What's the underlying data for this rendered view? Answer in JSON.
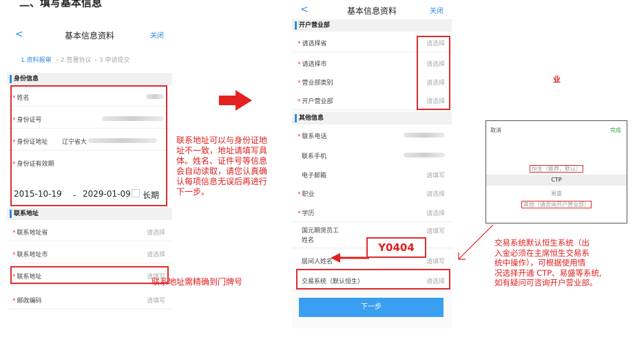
{
  "top_heading": "二、填写基本信息",
  "phone1": {
    "nav": {
      "back": "<",
      "title": "基本信息资料",
      "close": "关闭"
    },
    "steps": {
      "s1": "1.资料报审",
      "s2": "› 2.签署协议",
      "s3": "› 3.申请提交"
    },
    "sec_id": "身份信息",
    "name_label": "姓名",
    "id_label": "身份证号",
    "addr_label": "身份证地址",
    "addr_value": "辽宁省大",
    "validity_label": "身份证有效期",
    "date_start": "2015-10-19",
    "date_sep": "-",
    "date_end": "2029-01-09",
    "long_term": "长期",
    "sec_contact": "联系地址",
    "province_label": "联系地址省",
    "city_label": "联系地址市",
    "contact_addr_label": "联系地址",
    "zip_label": "邮政编码",
    "please_select": "请选择",
    "please_fill": "请填写"
  },
  "phone2": {
    "nav": {
      "back": "<",
      "title": "基本信息资料",
      "close": "关闭"
    },
    "sec_open": "开户营业部",
    "province": "请选择省",
    "city": "请选择市",
    "dept_type": "营业部类别",
    "open_dept": "开户营业部",
    "sec_other": "其他信息",
    "phone": "联系电话",
    "mobile": "联系手机",
    "email": "电子邮箱",
    "job": "职业",
    "edu": "学历",
    "staff_line1": "国元期货员工",
    "staff_line2": "姓名",
    "intermediary": "居间人姓名",
    "trade_system": "交易系统（默认恒生）",
    "please_select": "请选择",
    "please_fill": "请填写",
    "next": "下一步"
  },
  "annotations": {
    "anno1": [
      "联系地址可以与身份证地",
      "址不一致，地址请填写具",
      "体。姓名、证件号等信息",
      "会自动读取，请您认真确",
      "认每项信息无误后再进行",
      "下一步。"
    ],
    "anno2": "联系地址需精确到门牌号",
    "anno3": [
      "交易系统默认恒生系统（出",
      "入金必须在主席恒生交易系",
      "统中操作），可根据使用情",
      "况选择开通 CTP、易盛等系统,",
      "如有疑问可咨询开户营业部。"
    ],
    "right_mark": "业",
    "y_label": "Y0404"
  },
  "picker": {
    "cancel": "取消",
    "done": "完成",
    "opt1": "恒生（推荐，默认）",
    "opt2": "CTP",
    "opt3": "易盛",
    "opt4": "其他（请咨询开户营业部）"
  },
  "colors": {
    "accent": "#2b8be8",
    "red": "#e02a2a",
    "button": "#3a9ff0",
    "done_green": "#3aa63a"
  }
}
